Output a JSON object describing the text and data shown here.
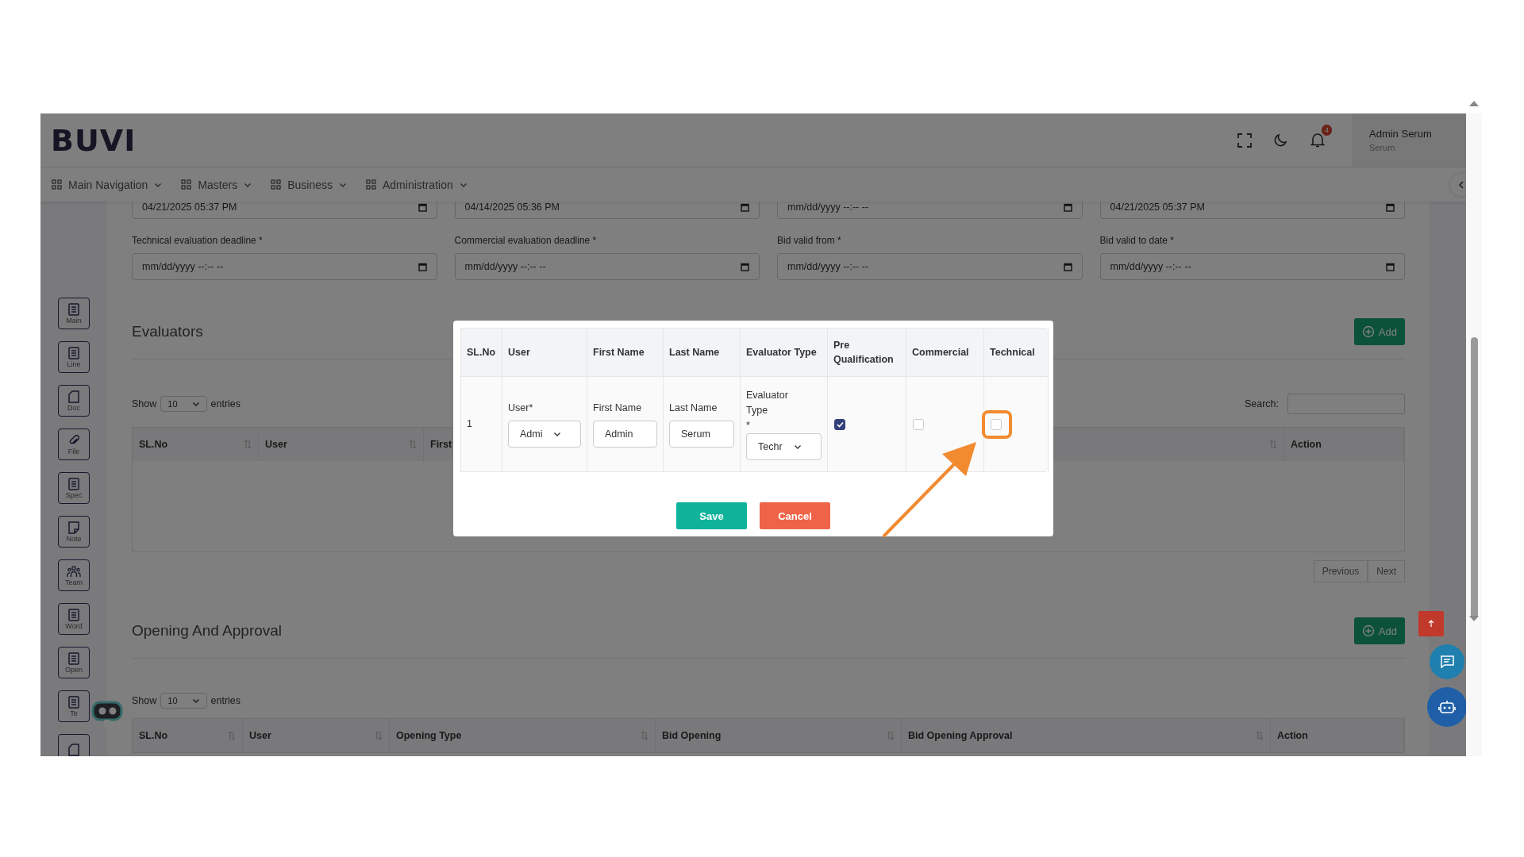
{
  "header": {
    "logo": "BUVI",
    "notification_count": "4",
    "user_name": "Admin Serum",
    "user_role": "Serum"
  },
  "nav": [
    {
      "label": "Main Navigation"
    },
    {
      "label": "Masters"
    },
    {
      "label": "Business"
    },
    {
      "label": "Administration"
    }
  ],
  "sidebar": [
    {
      "label": "Main",
      "kind": "list"
    },
    {
      "label": "Line",
      "kind": "list"
    },
    {
      "label": "Doc",
      "kind": "page"
    },
    {
      "label": "File",
      "kind": "clip"
    },
    {
      "label": "Spec",
      "kind": "list"
    },
    {
      "label": "Note",
      "kind": "note"
    },
    {
      "label": "Team",
      "kind": "team"
    },
    {
      "label": "Word",
      "kind": "list"
    },
    {
      "label": "Open",
      "kind": "list"
    },
    {
      "label": "Te",
      "kind": "list"
    },
    {
      "kind": "page"
    }
  ],
  "form": {
    "top_values": [
      "04/21/2025 05:37 PM",
      "04/14/2025 05:36 PM",
      "mm/dd/yyyy --:-- --",
      "04/21/2025 05:37 PM"
    ],
    "fields": [
      {
        "label": "Technical evaluation deadline *",
        "value": "mm/dd/yyyy --:-- --"
      },
      {
        "label": "Commercial evaluation deadline *",
        "value": "mm/dd/yyyy --:-- --"
      },
      {
        "label": "Bid valid from *",
        "value": "mm/dd/yyyy --:-- --"
      },
      {
        "label": "Bid valid to date *",
        "value": "mm/dd/yyyy --:-- --"
      }
    ]
  },
  "evaluators": {
    "title": "Evaluators",
    "add_label": "Add",
    "show_label": "Show",
    "page_size": "10",
    "entries_label": "entries",
    "search_label": "Search:",
    "columns": [
      "SL.No",
      "User",
      "First",
      "Action"
    ],
    "pagination": [
      "Previous",
      "Next"
    ]
  },
  "opening_approval": {
    "title": "Opening And Approval",
    "add_label": "Add",
    "show_label": "Show",
    "page_size": "10",
    "entries_label": "entries",
    "columns": [
      "SL.No",
      "User",
      "Opening Type",
      "Bid Opening",
      "Bid Opening Approval",
      "Action"
    ]
  },
  "modal": {
    "columns": [
      "SL.No",
      "User",
      "First Name",
      "Last Name",
      "Evaluator Type",
      "Pre Qualification",
      "Commercial",
      "Technical"
    ],
    "rows": [
      {
        "sl_no": "1",
        "user_label": "User*",
        "user_value": "Admi",
        "first_name_label": "First Name",
        "first_name": "Admin",
        "last_name_label": "Last Name",
        "last_name": "Serum",
        "evaluator_type_label": "Evaluator Type",
        "required_mark": "*",
        "evaluator_type": "Techr",
        "pre_qualification": true,
        "commercial": false,
        "technical": false
      }
    ],
    "buttons": [
      {
        "label": "Save",
        "kind": "primary"
      },
      {
        "label": "Cancel",
        "kind": "danger"
      }
    ]
  }
}
